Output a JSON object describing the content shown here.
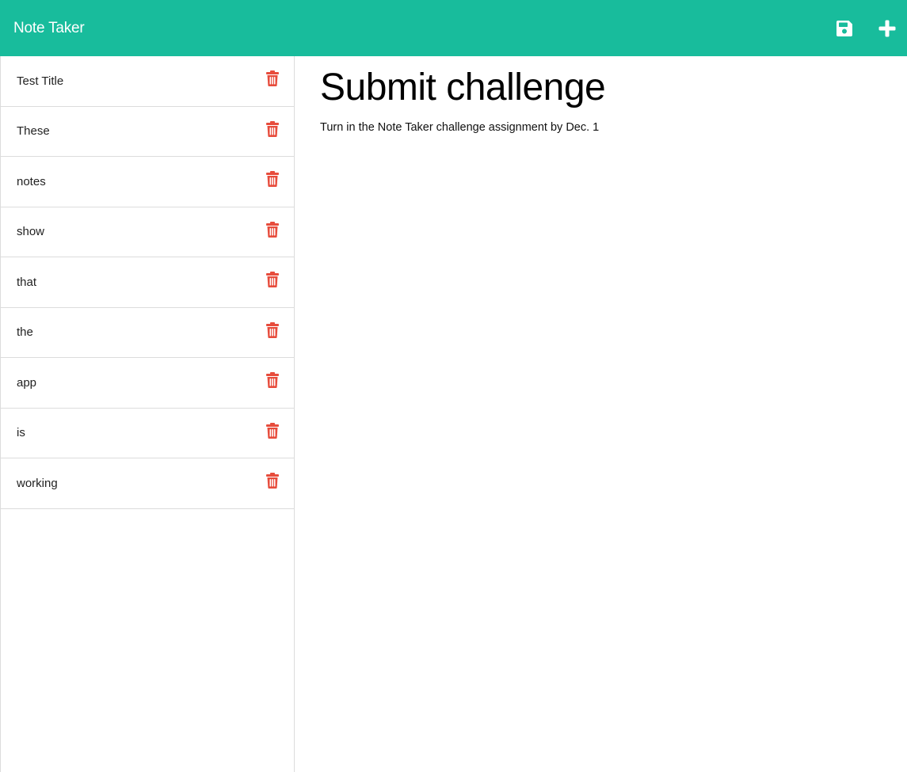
{
  "navbar": {
    "brand": "Note Taker",
    "save_icon": "floppy-disk-icon",
    "new_icon": "plus-icon",
    "background": "#18bc9c"
  },
  "sidebar": {
    "delete_icon": "trash-icon",
    "delete_color": "#e74c3c",
    "notes": [
      {
        "title": "Test Title"
      },
      {
        "title": "These"
      },
      {
        "title": "notes"
      },
      {
        "title": "show"
      },
      {
        "title": "that"
      },
      {
        "title": "the"
      },
      {
        "title": "app"
      },
      {
        "title": "is"
      },
      {
        "title": "working"
      }
    ]
  },
  "main": {
    "note_title": "Submit challenge",
    "note_text": "Turn in the Note Taker challenge assignment by Dec. 1"
  }
}
